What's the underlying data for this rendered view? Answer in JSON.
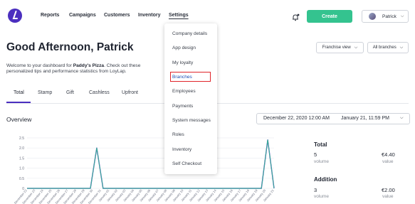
{
  "nav": {
    "items": [
      {
        "label": "Reports"
      },
      {
        "label": "Campaigns"
      },
      {
        "label": "Customers"
      },
      {
        "label": "Inventory"
      },
      {
        "label": "Settings"
      }
    ],
    "create_label": "Create",
    "user_name": "Patrick",
    "brand_color": "#4b2fbf",
    "create_color": "#34c38f",
    "bell_icon": "bell-icon"
  },
  "settings_menu": {
    "items": [
      {
        "label": "Company details"
      },
      {
        "label": "App design"
      },
      {
        "label": "My loyalty"
      },
      {
        "label": "Branches"
      },
      {
        "label": "Employees"
      },
      {
        "label": "Payments"
      },
      {
        "label": "System messages"
      },
      {
        "label": "Roles"
      },
      {
        "label": "Inventory"
      },
      {
        "label": "Self Checkout"
      }
    ],
    "highlight_color": "#e0242a"
  },
  "header": {
    "greeting": "Good Afternoon, Patrick",
    "welcome_pre": "Welcome to your dashboard for ",
    "business_name": "Paddy's Pizza",
    "welcome_post": ". Check out these personalized tips and performance statistics from LoyLap.",
    "franchise_dropdown": "Franchise view",
    "branches_dropdown": "All branches"
  },
  "tabs": [
    {
      "label": "Total"
    },
    {
      "label": "Stamp"
    },
    {
      "label": "Gift"
    },
    {
      "label": "Cashless"
    },
    {
      "label": "Upfront"
    }
  ],
  "overview": {
    "title": "Overview",
    "date_start": "December 22, 2020 12:00 AM",
    "date_end": "January 21, 11:59 PM"
  },
  "stats": [
    {
      "title": "Total",
      "count": "5",
      "count_label": "volume",
      "amount": "€4.40",
      "amount_label": "value"
    },
    {
      "title": "Addition",
      "count": "3",
      "count_label": "volume",
      "amount": "€2.00",
      "amount_label": "value"
    }
  ],
  "chart_data": {
    "type": "line",
    "y_ticks": [
      "2.5",
      "2.0",
      "1.5",
      "1.0",
      "0.5",
      "0"
    ],
    "ylim": [
      0,
      2.5
    ],
    "x": [
      "December 22",
      "December 23",
      "December 24",
      "December 25",
      "December 26",
      "December 27",
      "December 28",
      "December 29",
      "December 30",
      "December 31",
      "January 01",
      "January 02",
      "January 03",
      "January 04",
      "January 05",
      "January 06",
      "January 07",
      "January 08",
      "January 09",
      "January 10",
      "January 11",
      "January 12",
      "January 13",
      "January 14",
      "January 15",
      "January 16",
      "January 17",
      "January 18",
      "January 19",
      "January 20",
      "January 21"
    ],
    "series": [
      {
        "values": [
          0,
          0,
          0,
          0,
          0,
          0,
          0,
          0,
          0,
          0,
          0,
          2,
          0,
          0,
          0,
          0,
          0,
          0,
          0,
          0,
          0,
          0,
          0,
          0,
          0,
          0,
          0,
          0,
          0,
          0,
          0,
          0,
          0,
          0,
          0,
          0,
          0,
          0,
          2.4,
          0
        ]
      },
      {
        "values": [
          0,
          0,
          0,
          0,
          0,
          0,
          0,
          0,
          0,
          0,
          0,
          2,
          0,
          0,
          0,
          0,
          0,
          0,
          0,
          0,
          0,
          0,
          0,
          0,
          0,
          0,
          0,
          0,
          0,
          0,
          0,
          0,
          0,
          0,
          0,
          0,
          0,
          0,
          2.4,
          0
        ]
      }
    ],
    "colors": [
      "#4b2fbf",
      "#34c38f"
    ],
    "grid": true
  }
}
